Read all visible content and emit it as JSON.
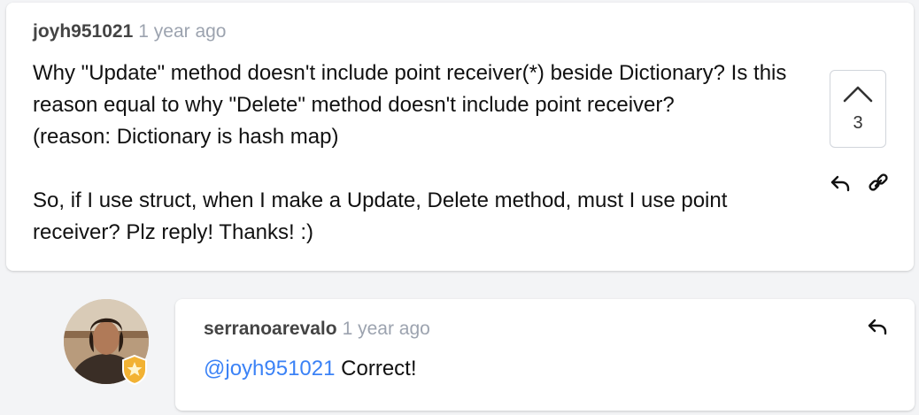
{
  "main_comment": {
    "username": "joyh951021",
    "timestamp": "1 year ago",
    "paragraphs": [
      "Why \"Update\" method doesn't include point receiver(*) beside Dictionary? Is this reason equal to why \"Delete\" method doesn't include point receiver?\n(reason: Dictionary is hash map)",
      "So, if I use struct, when I make a Update, Delete method, must I use point receiver? Plz reply! Thanks! :)"
    ],
    "upvote_count": "3",
    "icons": [
      "chevron-up-icon",
      "reply-icon",
      "link-icon"
    ]
  },
  "reply_comment": {
    "username": "serranoarevalo",
    "timestamp": "1 year ago",
    "mention": "@joyh951021",
    "text": " Correct!",
    "icons": [
      "avatar",
      "star-badge-icon",
      "reply-icon"
    ]
  },
  "colors": {
    "background": "#f3f4f6",
    "card": "#ffffff",
    "mention": "#3b82f6",
    "timestamp": "#9ca3af",
    "badge": "#f2b233"
  }
}
